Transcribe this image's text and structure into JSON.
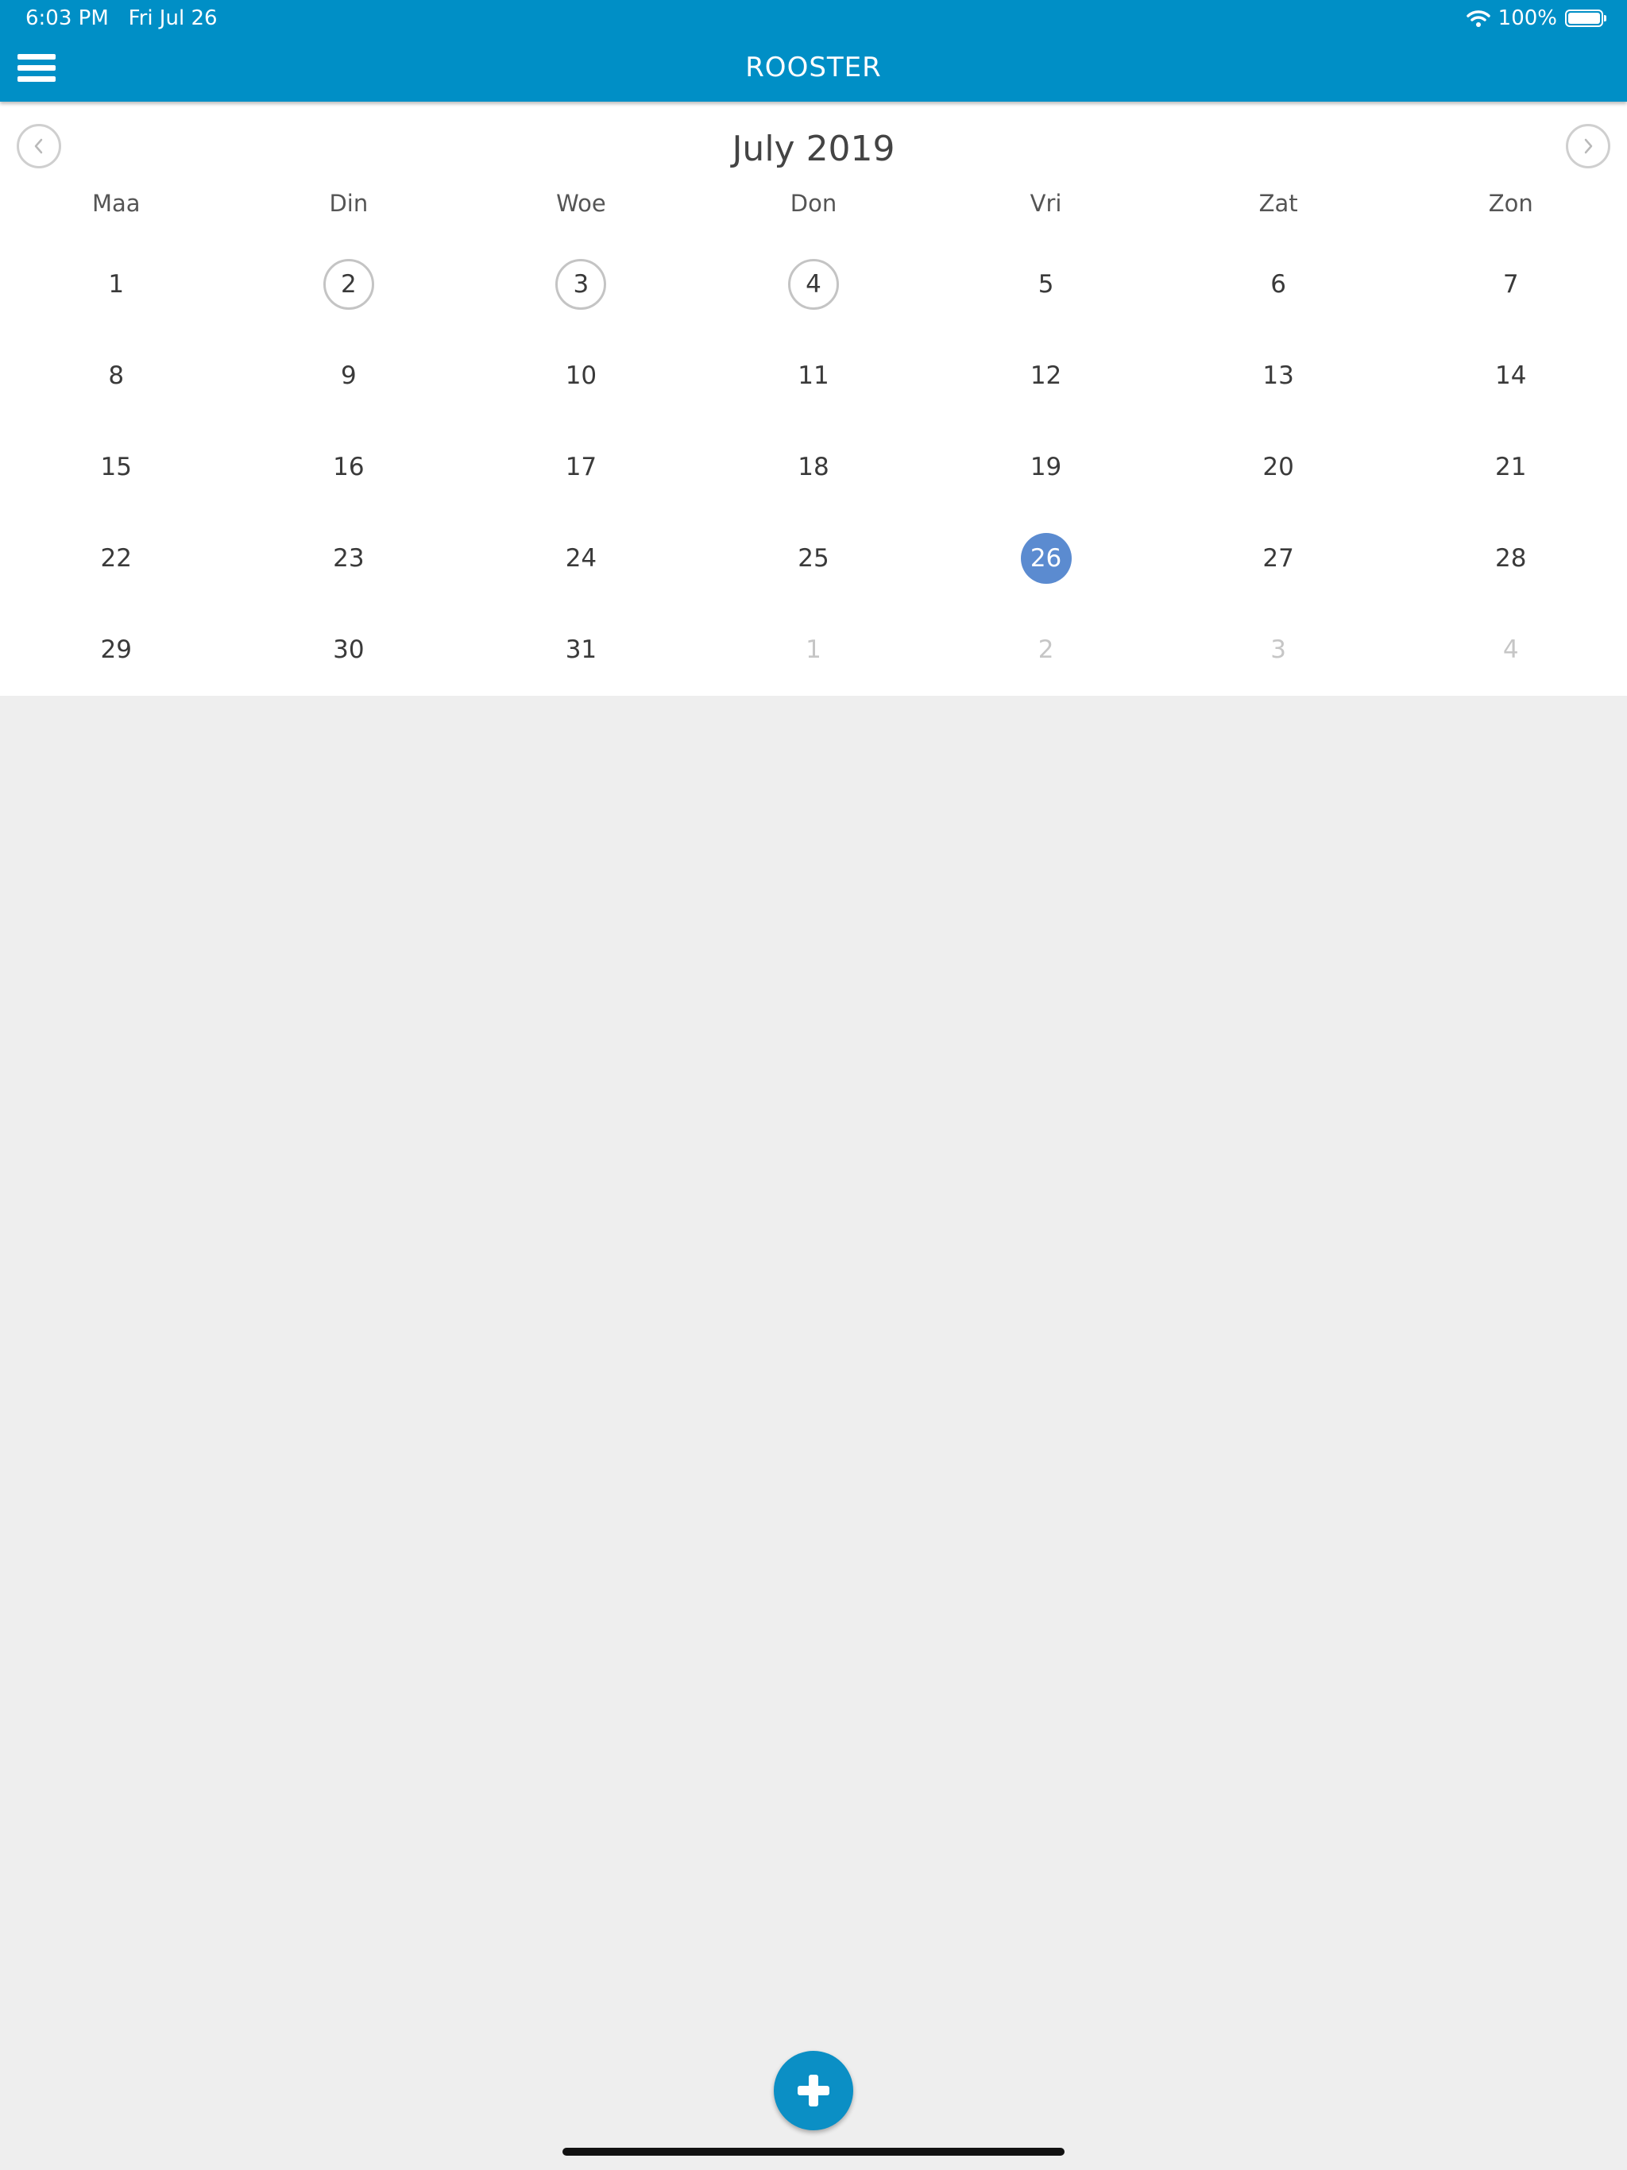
{
  "status_bar": {
    "time": "6:03 PM",
    "date": "Fri Jul 26",
    "battery_percent": "100%",
    "battery_level": 1.0,
    "wifi_icon": "wifi-icon",
    "battery_icon": "battery-icon"
  },
  "header": {
    "title": "ROOSTER",
    "menu_icon": "hamburger-menu-icon",
    "background_color": "#008fc6"
  },
  "calendar": {
    "month_title": "July 2019",
    "prev_icon": "chevron-left-icon",
    "next_icon": "chevron-right-icon",
    "weekdays": [
      "Maa",
      "Din",
      "Woe",
      "Don",
      "Vri",
      "Zat",
      "Zon"
    ],
    "selected_color": "#5b8bd0",
    "weeks": [
      [
        {
          "label": "1",
          "state": "normal"
        },
        {
          "label": "2",
          "state": "marked"
        },
        {
          "label": "3",
          "state": "marked"
        },
        {
          "label": "4",
          "state": "marked"
        },
        {
          "label": "5",
          "state": "normal"
        },
        {
          "label": "6",
          "state": "normal"
        },
        {
          "label": "7",
          "state": "normal"
        }
      ],
      [
        {
          "label": "8",
          "state": "normal"
        },
        {
          "label": "9",
          "state": "normal"
        },
        {
          "label": "10",
          "state": "normal"
        },
        {
          "label": "11",
          "state": "normal"
        },
        {
          "label": "12",
          "state": "normal"
        },
        {
          "label": "13",
          "state": "normal"
        },
        {
          "label": "14",
          "state": "normal"
        }
      ],
      [
        {
          "label": "15",
          "state": "normal"
        },
        {
          "label": "16",
          "state": "normal"
        },
        {
          "label": "17",
          "state": "normal"
        },
        {
          "label": "18",
          "state": "normal"
        },
        {
          "label": "19",
          "state": "normal"
        },
        {
          "label": "20",
          "state": "normal"
        },
        {
          "label": "21",
          "state": "normal"
        }
      ],
      [
        {
          "label": "22",
          "state": "normal"
        },
        {
          "label": "23",
          "state": "normal"
        },
        {
          "label": "24",
          "state": "normal"
        },
        {
          "label": "25",
          "state": "normal"
        },
        {
          "label": "26",
          "state": "selected"
        },
        {
          "label": "27",
          "state": "normal"
        },
        {
          "label": "28",
          "state": "normal"
        }
      ],
      [
        {
          "label": "29",
          "state": "normal"
        },
        {
          "label": "30",
          "state": "normal"
        },
        {
          "label": "31",
          "state": "normal"
        },
        {
          "label": "1",
          "state": "outside"
        },
        {
          "label": "2",
          "state": "outside"
        },
        {
          "label": "3",
          "state": "outside"
        },
        {
          "label": "4",
          "state": "outside"
        }
      ]
    ]
  },
  "fab": {
    "icon": "plus-icon",
    "color": "#0b8fc5"
  }
}
